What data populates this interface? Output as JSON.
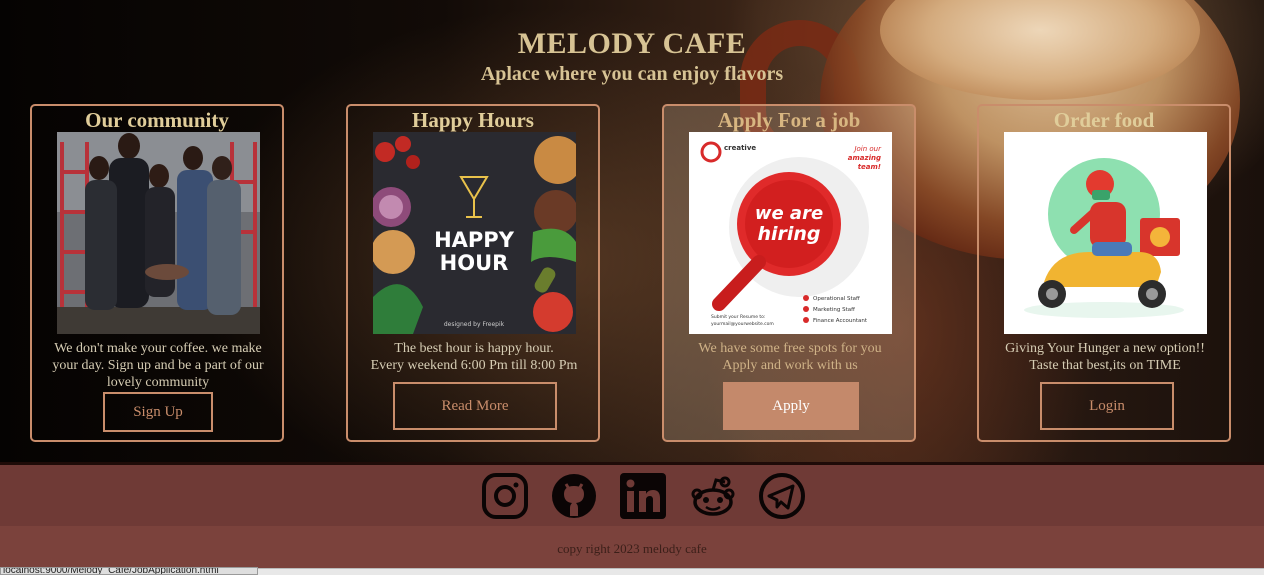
{
  "header": {
    "title": "MELODY CAFE",
    "subtitle": "Aplace where you can enjoy flavors"
  },
  "cards": [
    {
      "title": "Our community",
      "image_icon": "group-photo",
      "desc": [
        "We don't make your coffee. we make",
        "your day. Sign up and be a part of our",
        "lovely community"
      ],
      "button": "Sign Up"
    },
    {
      "title": "Happy Hours",
      "image_icon": "happy-hour-poster",
      "image_text": [
        "HAPPY",
        "HOUR",
        "designed by Freepik"
      ],
      "desc": [
        "The best hour is happy hour.",
        "Every weekend 6:00 Pm till 8:00 Pm"
      ],
      "button": "Read More"
    },
    {
      "title": "Apply For a job",
      "image_icon": "hiring-poster",
      "image_text": {
        "brand": "creative",
        "join": [
          "Join our",
          "amazing",
          "team!"
        ],
        "main": [
          "we are",
          "hiring"
        ],
        "roles": [
          "Operational Staff",
          "Marketing Staff",
          "Finance Accountant"
        ],
        "submit": [
          "Submit your Resume to:",
          "yourmail@yourwebsite.com"
        ]
      },
      "desc": [
        "We have some free spots for you",
        "Apply and work with us"
      ],
      "button": "Apply"
    },
    {
      "title": "Order food",
      "image_icon": "delivery-scooter",
      "desc": [
        "Giving Your Hunger a new option!!",
        "Taste that best,its on TIME"
      ],
      "button": "Login"
    }
  ],
  "social": [
    "instagram-icon",
    "github-icon",
    "linkedin-icon",
    "reddit-icon",
    "telegram-icon"
  ],
  "footer": {
    "copyright": "copy right 2023 melody cafe"
  },
  "status": {
    "url": "localhost:9000/Melody_Cafe/JobApplication.html"
  },
  "colors": {
    "title": "#d7c394",
    "border": "#c98d6b",
    "footer": "#6f3a36",
    "button_fill": "#c4896b"
  }
}
